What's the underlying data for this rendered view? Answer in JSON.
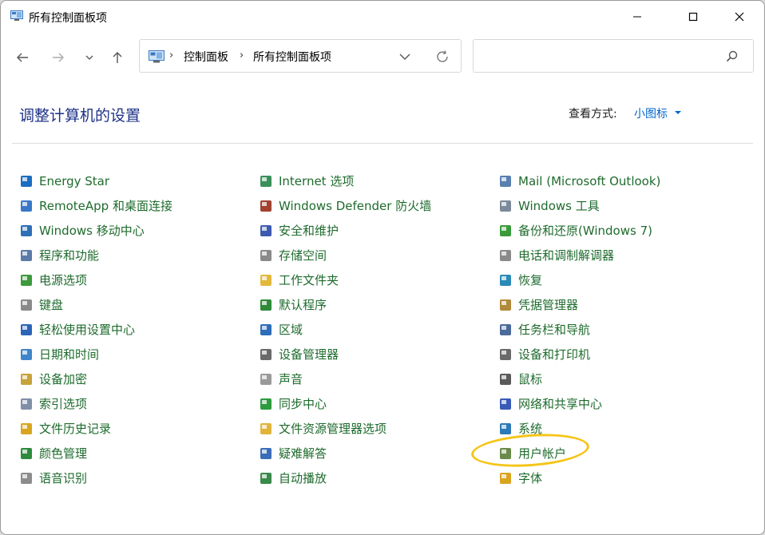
{
  "window": {
    "title": "所有控制面板项"
  },
  "address_bar": {
    "crumbs": [
      "控制面板",
      "所有控制面板项"
    ]
  },
  "search": {
    "placeholder": ""
  },
  "header": {
    "heading": "调整计算机的设置",
    "view_label": "查看方式:",
    "view_value": "小图标"
  },
  "columns": [
    [
      {
        "label": "Energy Star",
        "icon": "energy-star-icon",
        "color": "#1b6dc1"
      },
      {
        "label": "RemoteApp 和桌面连接",
        "icon": "remoteapp-icon",
        "color": "#3a78c7"
      },
      {
        "label": "Windows 移动中心",
        "icon": "mobility-center-icon",
        "color": "#2e6fb5"
      },
      {
        "label": "程序和功能",
        "icon": "programs-features-icon",
        "color": "#5a7aa8"
      },
      {
        "label": "电源选项",
        "icon": "power-options-icon",
        "color": "#3c9a3c"
      },
      {
        "label": "键盘",
        "icon": "keyboard-icon",
        "color": "#8a8a8a"
      },
      {
        "label": "轻松使用设置中心",
        "icon": "ease-of-access-icon",
        "color": "#2b64b8"
      },
      {
        "label": "日期和时间",
        "icon": "date-time-icon",
        "color": "#3f85c9"
      },
      {
        "label": "设备加密",
        "icon": "key-icon",
        "color": "#c8a23a"
      },
      {
        "label": "索引选项",
        "icon": "indexing-icon",
        "color": "#7f8fa6"
      },
      {
        "label": "文件历史记录",
        "icon": "file-history-icon",
        "color": "#d9a520"
      },
      {
        "label": "颜色管理",
        "icon": "color-management-icon",
        "color": "#2d8a3e"
      },
      {
        "label": "语音识别",
        "icon": "microphone-icon",
        "color": "#8c8c8c"
      }
    ],
    [
      {
        "label": "Internet 选项",
        "icon": "internet-options-icon",
        "color": "#3b8f5a"
      },
      {
        "label": "Windows Defender 防火墙",
        "icon": "firewall-icon",
        "color": "#a0422f"
      },
      {
        "label": "安全和维护",
        "icon": "flag-icon",
        "color": "#3d5ab0"
      },
      {
        "label": "存储空间",
        "icon": "storage-spaces-icon",
        "color": "#8a8a8a"
      },
      {
        "label": "工作文件夹",
        "icon": "work-folders-icon",
        "color": "#e2b93b"
      },
      {
        "label": "默认程序",
        "icon": "default-programs-icon",
        "color": "#2f8a3a"
      },
      {
        "label": "区域",
        "icon": "region-icon",
        "color": "#2e6db8"
      },
      {
        "label": "设备管理器",
        "icon": "device-manager-icon",
        "color": "#6a6a6a"
      },
      {
        "label": "声音",
        "icon": "speaker-icon",
        "color": "#9a9a9a"
      },
      {
        "label": "同步中心",
        "icon": "sync-center-icon",
        "color": "#2e9b3e"
      },
      {
        "label": "文件资源管理器选项",
        "icon": "folder-options-icon",
        "color": "#e0b43a"
      },
      {
        "label": "疑难解答",
        "icon": "troubleshooting-icon",
        "color": "#3a6db8"
      },
      {
        "label": "自动播放",
        "icon": "autoplay-icon",
        "color": "#3a8a4a"
      }
    ],
    [
      {
        "label": "Mail (Microsoft Outlook)",
        "icon": "mail-icon",
        "color": "#5a7fb0"
      },
      {
        "label": "Windows 工具",
        "icon": "windows-tools-icon",
        "color": "#7a8a9a"
      },
      {
        "label": "备份和还原(Windows 7)",
        "icon": "backup-restore-icon",
        "color": "#3a9a3a"
      },
      {
        "label": "电话和调制解调器",
        "icon": "phone-modem-icon",
        "color": "#8a8a8a"
      },
      {
        "label": "恢复",
        "icon": "recovery-icon",
        "color": "#2b8ab8"
      },
      {
        "label": "凭据管理器",
        "icon": "credential-manager-icon",
        "color": "#b08a3a"
      },
      {
        "label": "任务栏和导航",
        "icon": "taskbar-icon",
        "color": "#4a6a9a"
      },
      {
        "label": "设备和打印机",
        "icon": "printer-icon",
        "color": "#6a6a6a"
      },
      {
        "label": "鼠标",
        "icon": "mouse-icon",
        "color": "#5a5a5a"
      },
      {
        "label": "网络和共享中心",
        "icon": "network-sharing-icon",
        "color": "#3a5ab8"
      },
      {
        "label": "系统",
        "icon": "system-icon",
        "color": "#2e7ab8"
      },
      {
        "label": "用户帐户",
        "icon": "user-accounts-icon",
        "color": "#6a8a4a"
      },
      {
        "label": "字体",
        "icon": "fonts-icon",
        "color": "#d9a520"
      }
    ]
  ],
  "colors": {
    "link_green": "#1e6b2d",
    "heading_blue": "#1e3287",
    "accent_blue": "#0066cc",
    "highlight_yellow": "#f5c518"
  }
}
